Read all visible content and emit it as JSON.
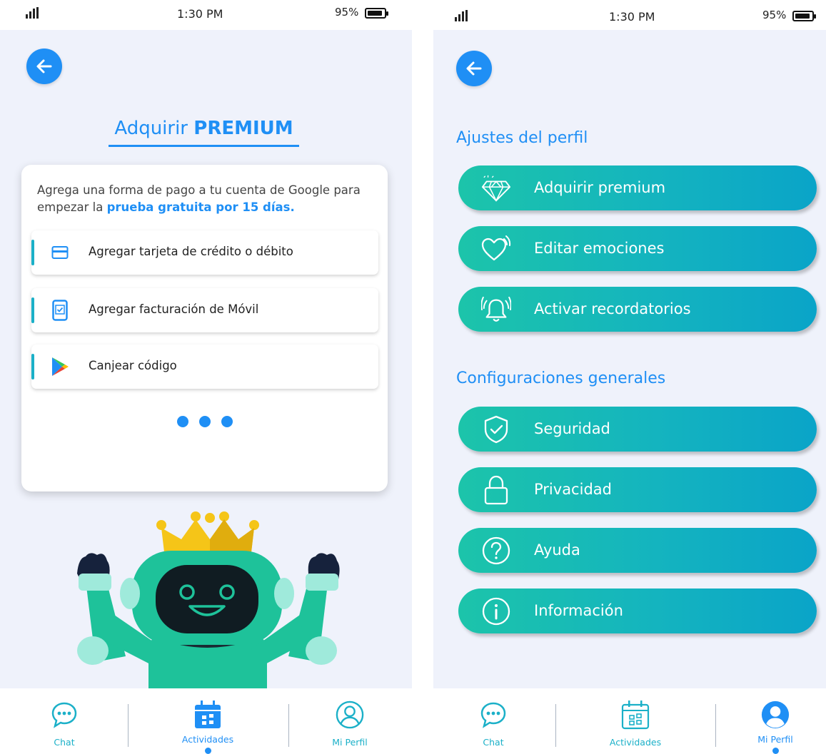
{
  "colors": {
    "accent": "#1f8ff5",
    "teal": "#1bb0c8",
    "background": "#eff2fb",
    "crown": "#f5c518",
    "robot": "#1ec29a"
  },
  "status_bar": {
    "time": "1:30 PM",
    "battery": "95%"
  },
  "premium_screen": {
    "title_prefix": "Adquirir ",
    "title_bold": "PREMIUM",
    "description_prefix": "Agrega una forma de pago a tu cuenta de Google para empezar la ",
    "description_highlight": "prueba gratuita por 15 días.",
    "options": [
      {
        "label": "Agregar tarjeta de crédito o débito",
        "icon": "credit-card-icon"
      },
      {
        "label": "Agregar facturación de Móvil",
        "icon": "mobile-phone-icon"
      },
      {
        "label": "Canjear código",
        "icon": "google-play-icon"
      }
    ]
  },
  "profile_screen": {
    "section_profile": "Ajustes del perfil",
    "profile_items": [
      {
        "label": "Adquirir premium",
        "icon": "diamond-icon"
      },
      {
        "label": "Editar emociones",
        "icon": "heart-icon"
      },
      {
        "label": "Activar recordatorios",
        "icon": "bell-icon"
      }
    ],
    "section_general": "Configuraciones generales",
    "general_items": [
      {
        "label": "Seguridad",
        "icon": "shield-icon"
      },
      {
        "label": "Privacidad",
        "icon": "lock-icon"
      },
      {
        "label": "Ayuda",
        "icon": "help-icon"
      },
      {
        "label": "Información",
        "icon": "info-icon"
      }
    ]
  },
  "nav": {
    "chat": "Chat",
    "activities": "Actividades",
    "profile": "Mi Perfil"
  },
  "active_tab": {
    "left_screen": "Actividades",
    "right_screen": "Mi Perfil"
  }
}
